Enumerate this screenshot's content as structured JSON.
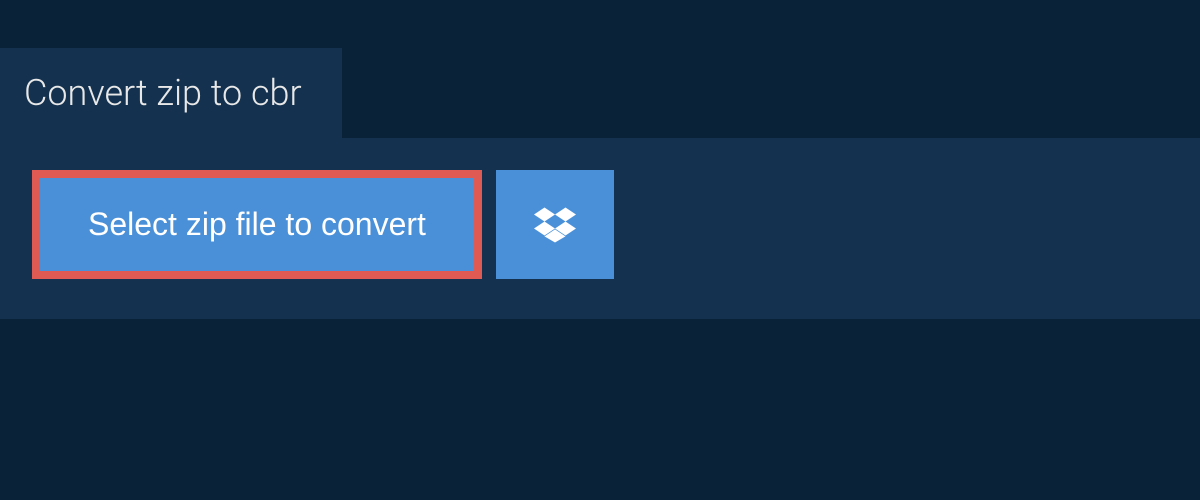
{
  "tab": {
    "title": "Convert zip to cbr"
  },
  "actions": {
    "select_label": "Select zip file to convert"
  }
}
